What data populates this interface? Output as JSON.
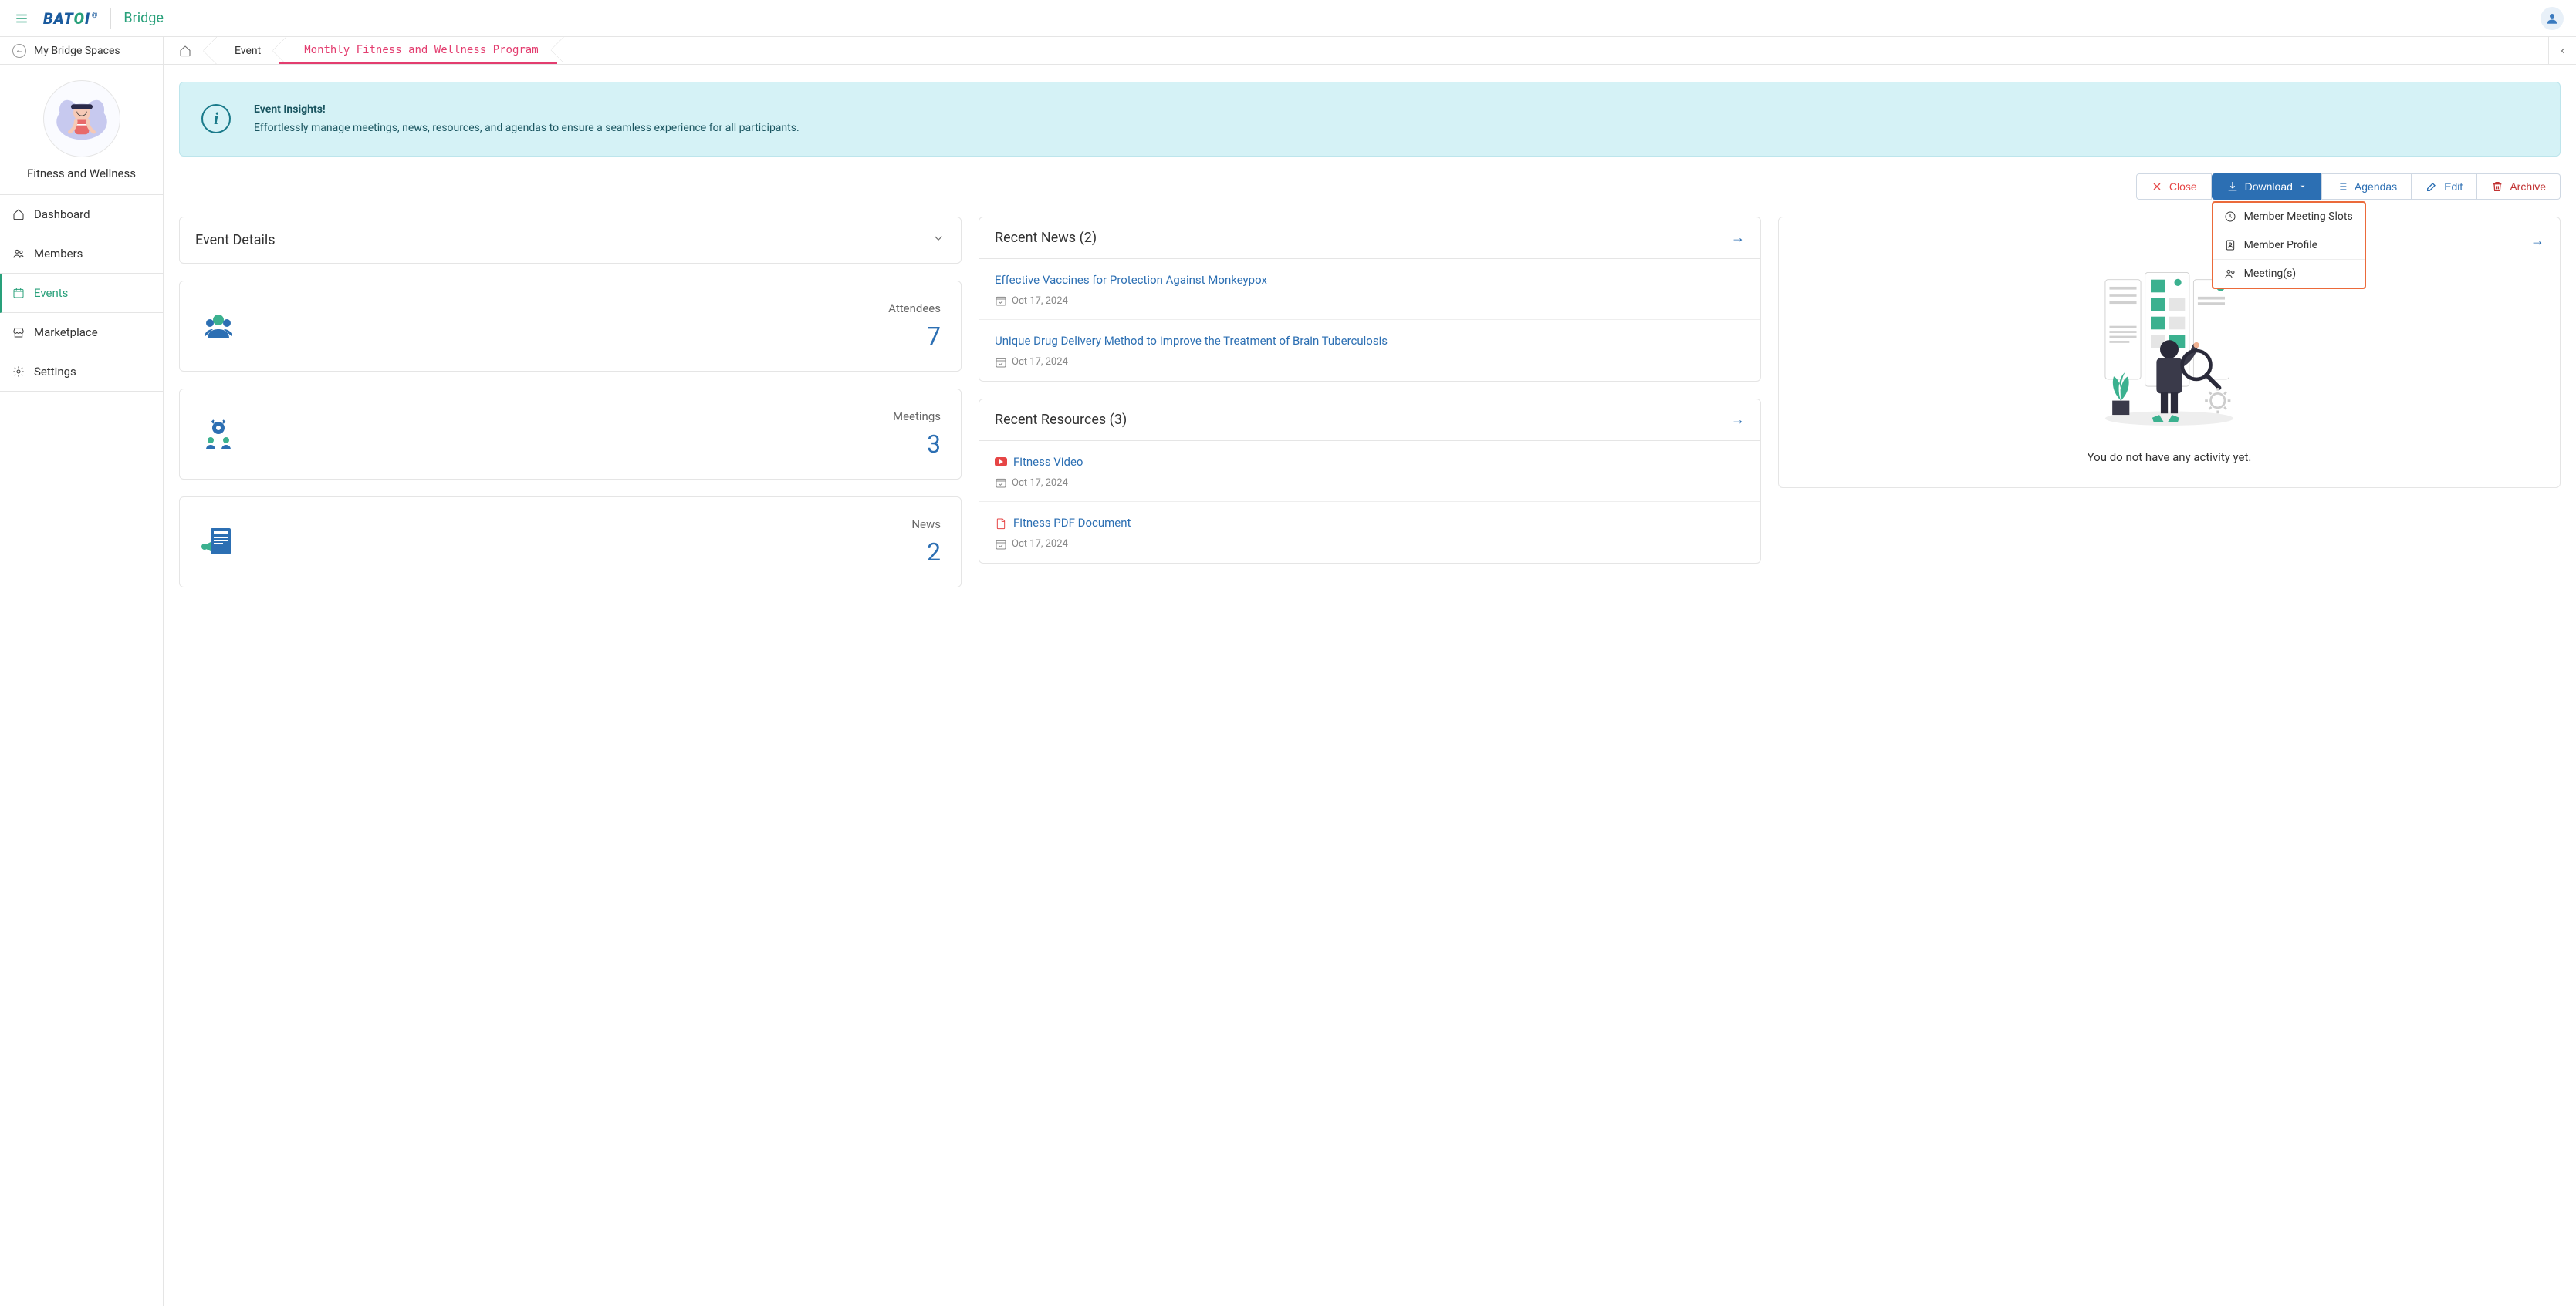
{
  "topbar": {
    "logo_primary": "BAT",
    "logo_green": "O",
    "logo_suffix": "I",
    "brand_link": "Bridge"
  },
  "breadcrumb": {
    "back_label": "My Bridge Spaces",
    "items": [
      "Event",
      "Monthly Fitness and Wellness Program"
    ]
  },
  "sidebar": {
    "workspace_name": "Fitness and Wellness",
    "items": [
      {
        "label": "Dashboard"
      },
      {
        "label": "Members"
      },
      {
        "label": "Events"
      },
      {
        "label": "Marketplace"
      },
      {
        "label": "Settings"
      }
    ]
  },
  "alert": {
    "title": "Event Insights!",
    "body": "Effortlessly manage meetings, news, resources, and agendas to ensure a seamless experience for all participants."
  },
  "actions": {
    "close": "Close",
    "download": "Download",
    "agendas": "Agendas",
    "edit": "Edit",
    "archive": "Archive",
    "download_menu": [
      "Member Meeting Slots",
      "Member Profile",
      "Meeting(s)"
    ]
  },
  "event_details": {
    "title": "Event Details"
  },
  "stats": {
    "attendees": {
      "label": "Attendees",
      "value": "7"
    },
    "meetings": {
      "label": "Meetings",
      "value": "3"
    },
    "news": {
      "label": "News",
      "value": "2"
    }
  },
  "recent_news": {
    "title": "Recent News (2)",
    "items": [
      {
        "title": "Effective Vaccines for Protection Against Monkeypox",
        "date": "Oct 17, 2024"
      },
      {
        "title": "Unique Drug Delivery Method to Improve the Treatment of Brain Tuberculosis",
        "date": "Oct 17, 2024"
      }
    ]
  },
  "recent_resources": {
    "title": "Recent Resources (3)",
    "items": [
      {
        "title": "Fitness Video",
        "date": "Oct 17, 2024",
        "type": "video"
      },
      {
        "title": "Fitness PDF Document",
        "date": "Oct 17, 2024",
        "type": "pdf"
      }
    ]
  },
  "activity": {
    "empty_text": "You do not have any activity yet."
  }
}
